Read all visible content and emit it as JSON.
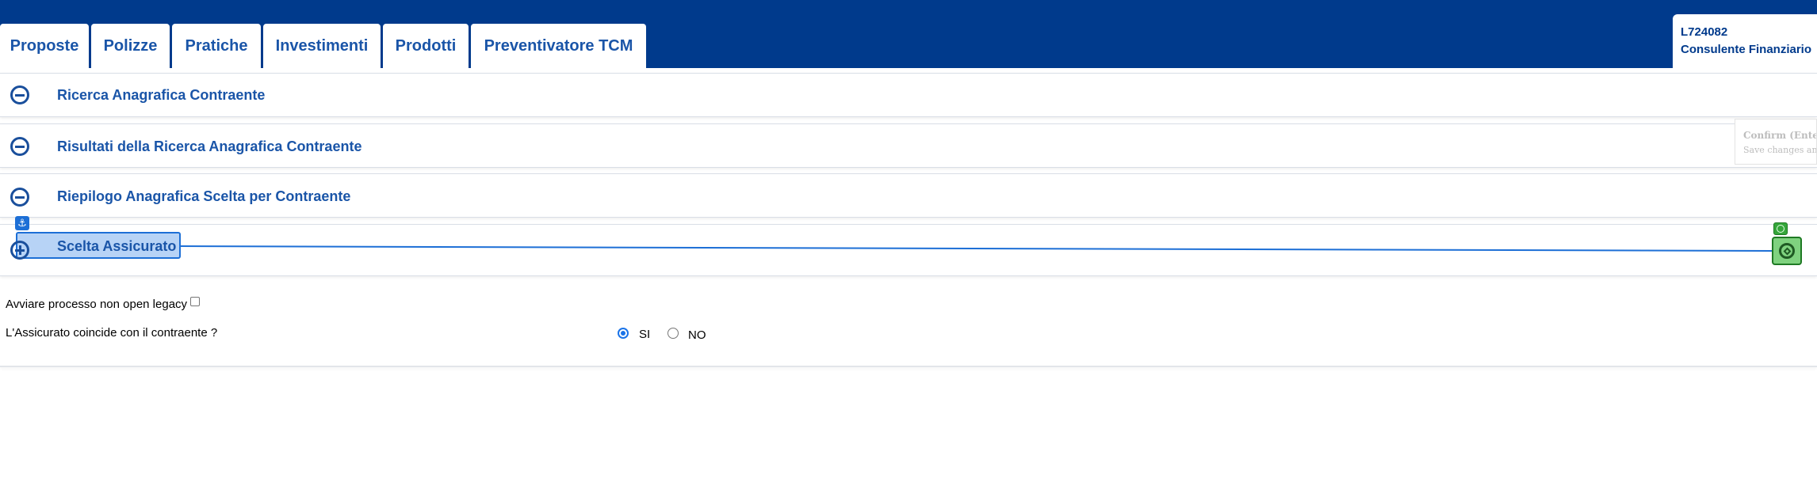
{
  "tabs": [
    {
      "label": "Proposte"
    },
    {
      "label": "Polizze"
    },
    {
      "label": "Pratiche"
    },
    {
      "label": "Investimenti"
    },
    {
      "label": "Prodotti"
    },
    {
      "label": "Preventivatore TCM"
    }
  ],
  "user": {
    "code": "L724082",
    "role": "Consulente Finanziario"
  },
  "sections": [
    {
      "title": "Ricerca Anagrafica Contraente",
      "icon": "minus-circle-icon"
    },
    {
      "title": "Risultati della Ricerca Anagrafica Contraente",
      "icon": "minus-circle-icon"
    },
    {
      "title": "Riepilogo Anagrafica Scelta per Contraente",
      "icon": "minus-circle-icon"
    },
    {
      "title": "Scelta Assicurato",
      "icon": "plus-circle-icon"
    }
  ],
  "tooltip": {
    "title": "Confirm (Enter)",
    "subtitle": "Save changes and"
  },
  "form": {
    "legacy_label": "Avviare processo non open legacy",
    "insured_question": "L'Assicurato coincide con il contraente ?",
    "yes_label": "SI",
    "no_label": "NO",
    "selected": "SI"
  },
  "colors": {
    "topbar": "#003a8c",
    "tab_text": "#1a55a8",
    "highlight": "#b7d3f6",
    "target": "#35a63a"
  }
}
